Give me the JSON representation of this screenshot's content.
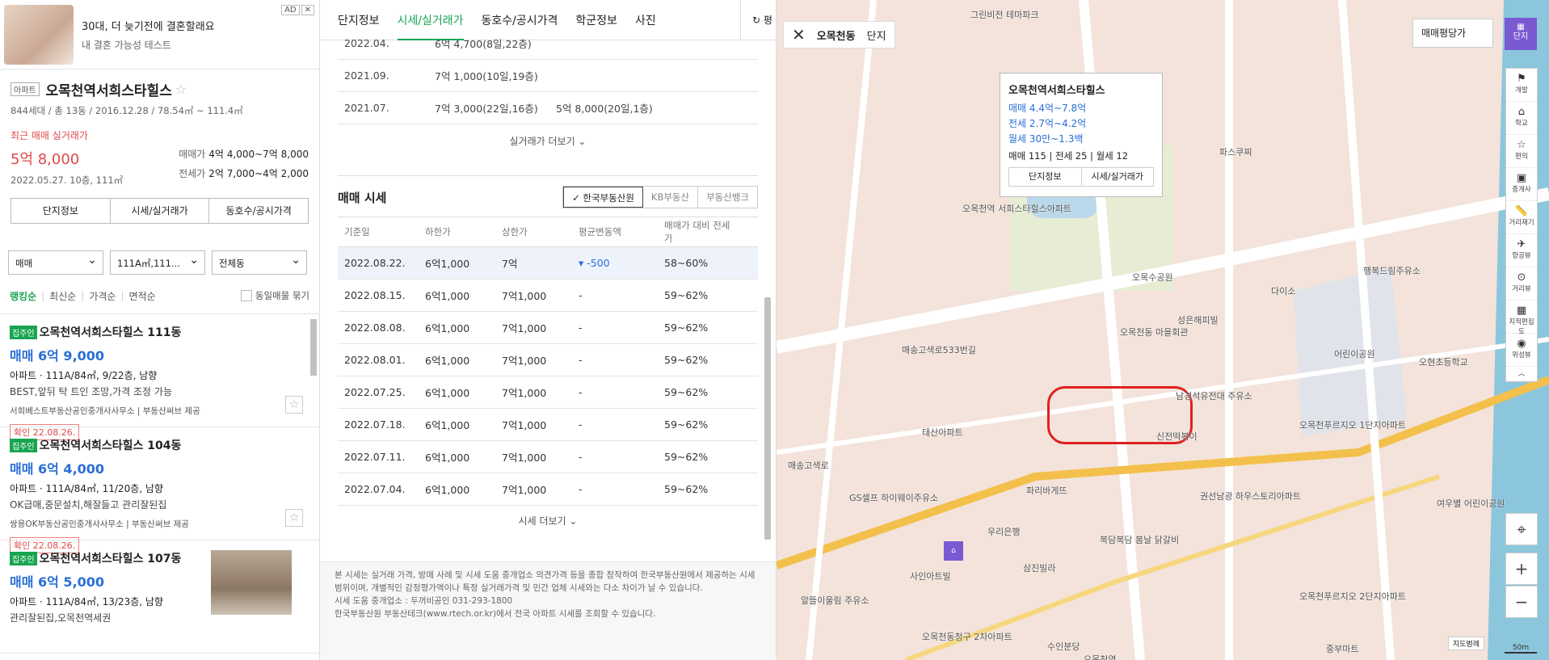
{
  "ad": {
    "badge": "AD",
    "close": "✕",
    "title": "30대, 더 늦기전에 결혼할래요",
    "subtitle": "내 결혼 가능성 테스트"
  },
  "complex": {
    "type": "아파트",
    "name": "오목천역서희스타힐스",
    "star": "☆",
    "info": "844세대 / 총 13동 / 2016.12.28 / 78.54㎡ ~ 111.4㎡",
    "recent_label": "최근 매매 실거래가",
    "recent_price": "5억 8,000",
    "recent_date": "2022.05.27. 10층, 111㎡",
    "sale_key": "매매가",
    "sale_range": "4억 4,000~7억 8,000",
    "jeonse_key": "전세가",
    "jeonse_range": "2억 7,000~4억 2,000",
    "tabs": [
      "단지정보",
      "시세/실거래가",
      "동호수/공시가격"
    ]
  },
  "filters": {
    "trade": "매매",
    "area": "111A㎡,111...",
    "dong": "전체동"
  },
  "sort": {
    "items": [
      "랭킹순",
      "최신순",
      "가격순",
      "면적순"
    ],
    "same_listing": "동일매물 묶기"
  },
  "listings": [
    {
      "badge": "집주인",
      "title": "오목천역서희스타힐스 111동",
      "price": "매매 6억 9,000",
      "spec": "아파트 · 111A/84㎡, 9/22층, 남향",
      "desc": "BEST,앞뒤 탁 트인 조망,가격 조정 가능",
      "agent": "서희베스트부동산공인중개사사무소 | 부동산써브 제공",
      "confirm": "확인 22.08.26."
    },
    {
      "badge": "집주인",
      "title": "오목천역서희스타힐스 104동",
      "price": "매매 6억 4,000",
      "spec": "아파트 · 111A/84㎡, 11/20층, 남향",
      "desc": "OK급매,중문설치,해잘들고 관리잘된집",
      "agent": "쌍용OK부동산공인중개사사무소 | 부동산써브 제공",
      "confirm": "확인 22.08.26."
    },
    {
      "badge": "집주인",
      "title": "오목천역서희스타힐스 107동",
      "price": "매매 6억 5,000",
      "spec": "아파트 · 111A/84㎡, 13/23층, 남향",
      "desc": "관리잘된집,오목천역세권",
      "agent": "",
      "confirm": ""
    }
  ],
  "mid": {
    "tabs": [
      "단지정보",
      "시세/실거래가",
      "동호수/공시가격",
      "학군정보",
      "사진"
    ],
    "refresh": "↻ 평",
    "real_rows": [
      {
        "date": "2022.04.",
        "v1": "6억 4,700(8일,22층)",
        "v2": ""
      },
      {
        "date": "2021.09.",
        "v1": "7억 1,000(10일,19층)",
        "v2": ""
      },
      {
        "date": "2021.07.",
        "v1": "7억 3,000(22일,16층)",
        "v2": "5억 8,000(20일,1층)"
      }
    ],
    "real_more": "실거래가 더보기 ⌄",
    "sise_title": "매매 시세",
    "sources": [
      "✓ 한국부동산원",
      "KB부동산",
      "부동산뱅크"
    ],
    "headers": [
      "기준일",
      "하한가",
      "상한가",
      "평균변동액",
      "매매가 대비 전세가"
    ],
    "rows": [
      {
        "date": "2022.08.22.",
        "low": "6억1,000",
        "high": "7억",
        "chg": "▾ -500",
        "ratio": "58~60%"
      },
      {
        "date": "2022.08.15.",
        "low": "6억1,000",
        "high": "7억1,000",
        "chg": "-",
        "ratio": "59~62%"
      },
      {
        "date": "2022.08.08.",
        "low": "6억1,000",
        "high": "7억1,000",
        "chg": "-",
        "ratio": "59~62%"
      },
      {
        "date": "2022.08.01.",
        "low": "6억1,000",
        "high": "7억1,000",
        "chg": "-",
        "ratio": "59~62%"
      },
      {
        "date": "2022.07.25.",
        "low": "6억1,000",
        "high": "7억1,000",
        "chg": "-",
        "ratio": "59~62%"
      },
      {
        "date": "2022.07.18.",
        "low": "6억1,000",
        "high": "7억1,000",
        "chg": "-",
        "ratio": "59~62%"
      },
      {
        "date": "2022.07.11.",
        "low": "6억1,000",
        "high": "7억1,000",
        "chg": "-",
        "ratio": "59~62%"
      },
      {
        "date": "2022.07.04.",
        "low": "6억1,000",
        "high": "7억1,000",
        "chg": "-",
        "ratio": "59~62%"
      }
    ],
    "sise_more": "시세 더보기 ⌄",
    "footer1": "본 시세는 실거래 가격, 방매 사례 및 시세 도움 중개업소 의견가격 등을 종합 참작하여 한국부동산원에서 제공하는 시세 범위이며, 개별적인 감정평가액이나 특정 실거래가격 및 민간 업체 시세와는 다소 차이가 날 수 있습니다.",
    "footer2": "시세 도움 중개업소 : 두꺼비공인 031-293-1800",
    "footer3": "한국부동산원 부동산테크(www.rtech.or.kr)에서 전국 아파트 시세를 조회할 수 있습니다."
  },
  "map": {
    "region": "오목천동",
    "level": "단지",
    "price_type": "매매평당가",
    "danji_btn": "단지",
    "popup": {
      "name": "오목천역서희스타힐스",
      "sale": "매매 4.4억~7.8억",
      "jeonse": "전세 2.7억~4.2억",
      "monthly": "월세 30만~1.3백",
      "cnt_sale": "매매 115",
      "cnt_jeonse": "전세 25",
      "cnt_monthly": "월세 12",
      "btn1": "단지정보",
      "btn2": "시세/실거래가"
    },
    "tools": [
      "개발",
      "학교",
      "편의",
      "중개사",
      "거리재기",
      "항공뷰",
      "거리뷰",
      "지적편집도",
      "위성뷰"
    ],
    "scale": "50m",
    "jido": "지도범례",
    "labels": [
      "그린비전 테마파크",
      "파스쿠찌",
      "오목천역 서희스타힐스아파트",
      "오목수공원",
      "다이소",
      "행복드림주유소",
      "성은해피빌",
      "오목천동 마을회관",
      "오목천동",
      "어린이공원",
      "오현초등학교",
      "남경석유전대 주유소",
      "오목천푸르지오 1단지아파트",
      "태산아파트",
      "신전떡볶이",
      "권선남광 하우스토리아파트",
      "파리바게뜨",
      "GS셀프 하이웨이주유소",
      "우리은행",
      "복담복담 봄날 닭갈비",
      "사인아트빌",
      "삼진빌라",
      "오목천푸르지오 2단지아파트",
      "알뜰이울림 주유소",
      "오목천동청구 2차아파트",
      "여우별 어린이공원",
      "중부마트",
      "수인분당",
      "오목천역",
      "매송고색로",
      "매송고색로533번길"
    ]
  }
}
